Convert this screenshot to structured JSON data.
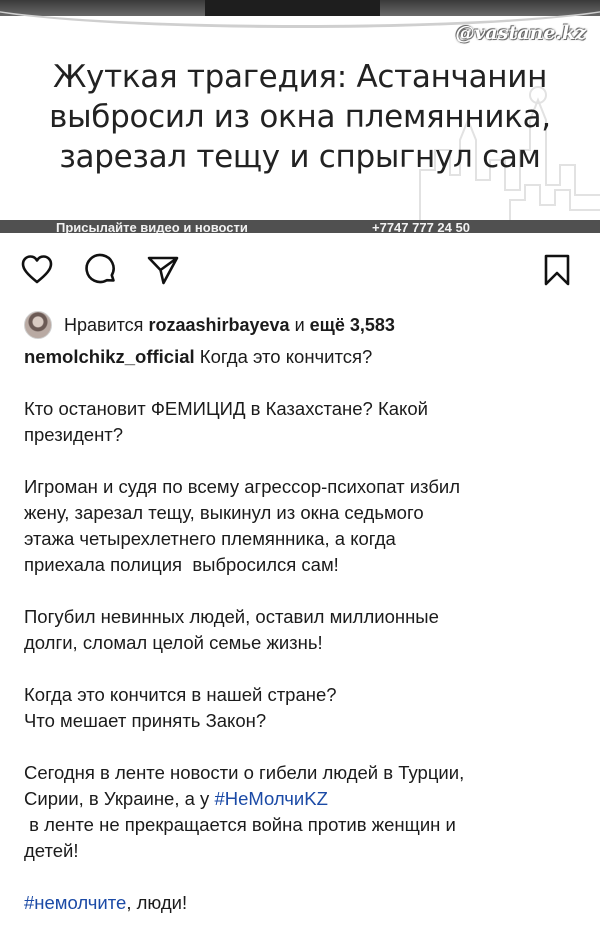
{
  "post_image": {
    "headline_lines": [
      "Жуткая трагедия: Астанчанин",
      "выбросил из окна племянника,",
      "зарезал тещу и спрыгнул сам"
    ],
    "watermark": "@vastane.kz",
    "band_left_text": "Присылайте видео и новости",
    "band_right_text": "+7747 777 24 50"
  },
  "actions": {
    "like": "heart-icon",
    "comment": "comment-icon",
    "share": "send-icon",
    "save": "bookmark-icon"
  },
  "likes": {
    "prefix": "Нравится",
    "user": "rozaashirbayeva",
    "middle": "и",
    "count_label": "ещё 3,583"
  },
  "caption": {
    "username": "nemolchikz_official",
    "paragraphs": [
      [
        "Когда это кончится?"
      ],
      [
        "Кто остановит ФЕМИЦИД в Казахстане? Какой",
        "президент?"
      ],
      [
        "Игроман и судя по всему агрессор-психопат избил",
        "жену, зарезал тещу, выкинул из окна седьмого",
        "этажа четырехлетнего племянника, а когда",
        "приехала полиция  выбросился сам!"
      ],
      [
        "Погубил невинных людей, оставил миллионные",
        "долги, сломал целой семье жизнь!"
      ],
      [
        "Когда это кончится в нашей стране?",
        "Что мешает принять Закон?"
      ],
      [
        "Сегодня в ленте новости о гибели людей в Турции,",
        "Сирии, в Украине, а у"
      ],
      [
        " в ленте не прекращается война против женщин и",
        "детей!"
      ],
      [
        ", люди!"
      ]
    ],
    "hashtag1": "#НеМолчиKZ",
    "hashtag2": "#немолчите"
  },
  "colors": {
    "hashtag": "#1b4aa6",
    "text": "#1b1b1b",
    "band": "#505050"
  }
}
